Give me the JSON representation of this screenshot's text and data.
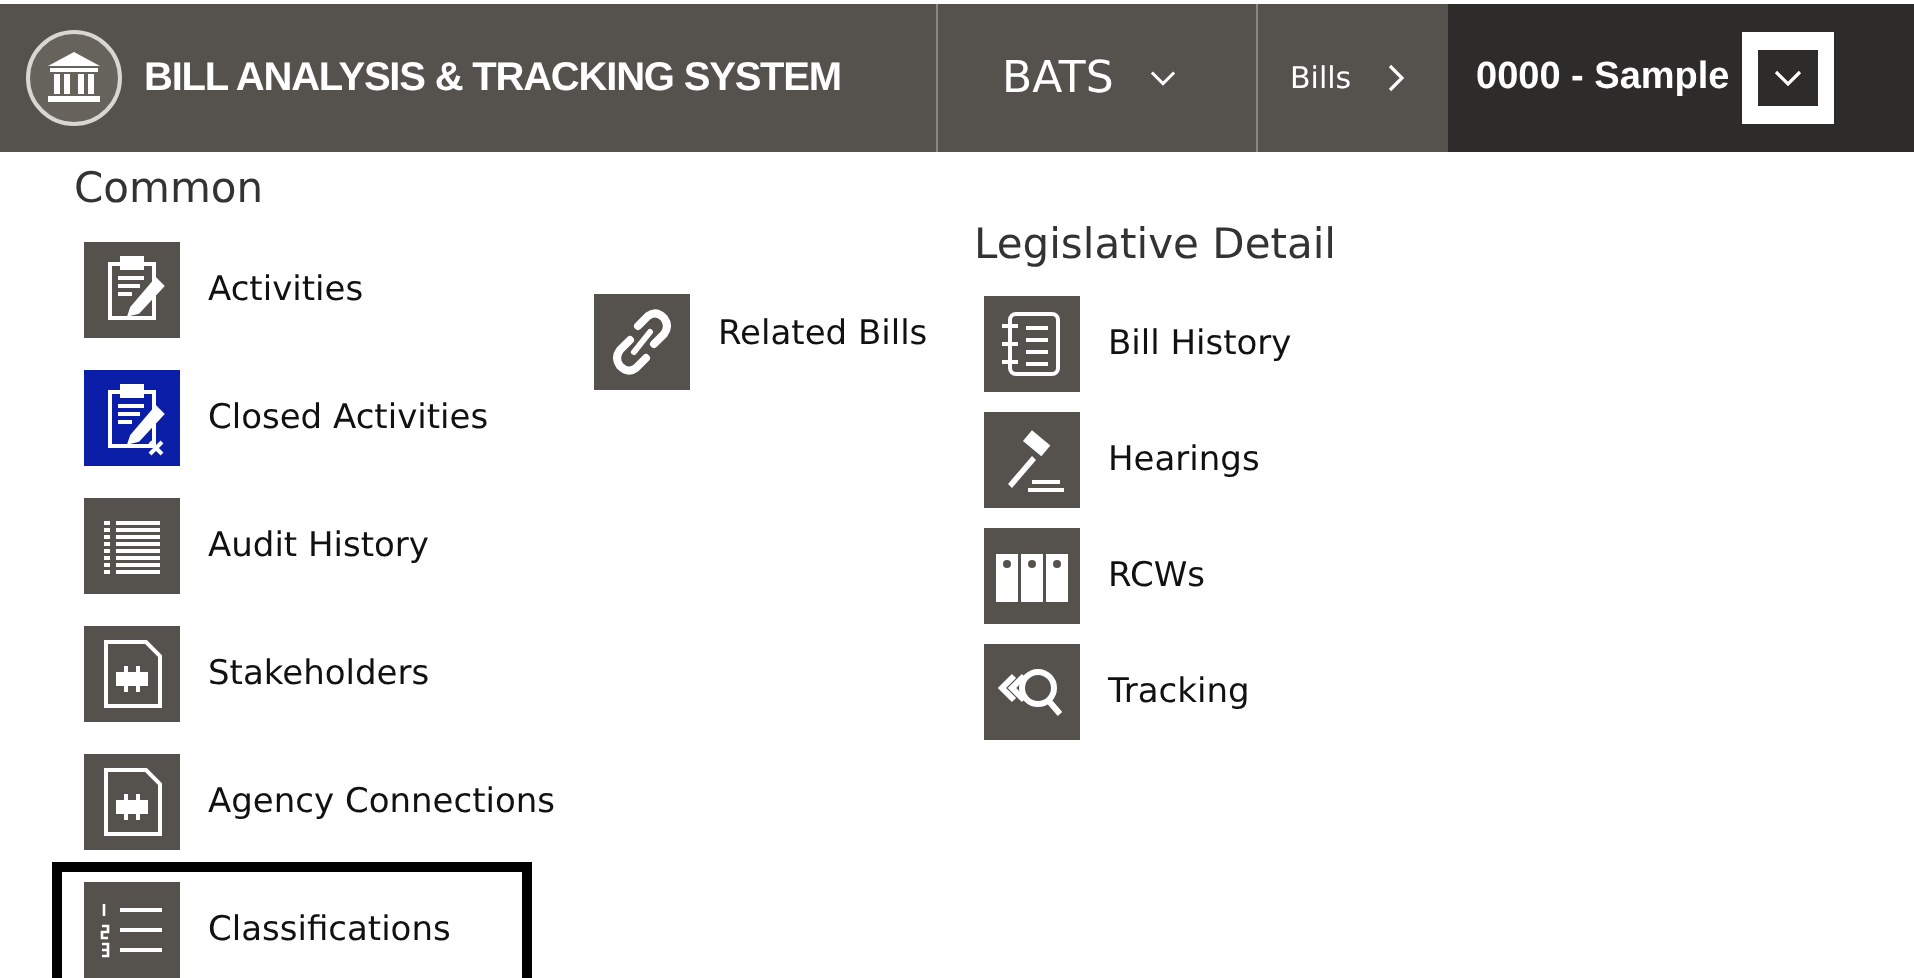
{
  "header": {
    "title": "BILL ANALYSIS & TRACKING SYSTEM",
    "app_menu": "BATS",
    "breadcrumb": "Bills",
    "record": "0000 - Sample"
  },
  "columns": [
    {
      "heading": "Common",
      "items": [
        {
          "label": "Activities",
          "kind": "clipboard",
          "highlighted": false,
          "selected": false
        },
        {
          "label": "Closed Activities",
          "kind": "clipboard-x",
          "highlighted": true,
          "selected": false
        },
        {
          "label": "Audit History",
          "kind": "list",
          "highlighted": false,
          "selected": false
        },
        {
          "label": "Stakeholders",
          "kind": "puzzle",
          "highlighted": false,
          "selected": false
        },
        {
          "label": "Agency Connections",
          "kind": "puzzle",
          "highlighted": false,
          "selected": false
        },
        {
          "label": "Classifications",
          "kind": "numbered-list",
          "highlighted": false,
          "selected": true
        }
      ]
    },
    {
      "items": [
        {
          "label": "Related Bills",
          "kind": "link",
          "highlighted": false,
          "selected": false
        }
      ]
    },
    {
      "heading": "Legislative Detail",
      "items": [
        {
          "label": "Bill History",
          "kind": "notebook",
          "highlighted": false,
          "selected": false
        },
        {
          "label": "Hearings",
          "kind": "gavel",
          "highlighted": false,
          "selected": false
        },
        {
          "label": "RCWs",
          "kind": "binders",
          "highlighted": false,
          "selected": false
        },
        {
          "label": "Tracking",
          "kind": "search-back",
          "highlighted": false,
          "selected": false
        }
      ]
    }
  ]
}
